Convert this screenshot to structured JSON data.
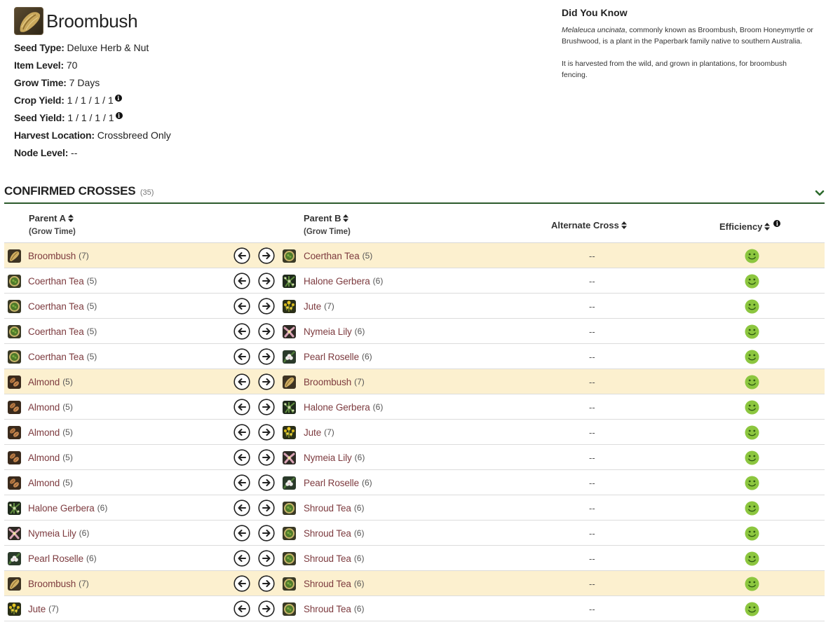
{
  "item": {
    "title": "Broombush",
    "icon": "broombush-icon",
    "props": [
      {
        "key": "Seed Type:",
        "value": "Deluxe Herb & Nut",
        "info": false
      },
      {
        "key": "Item Level:",
        "value": "70",
        "info": false
      },
      {
        "key": "Grow Time:",
        "value": "7 Days",
        "info": false
      },
      {
        "key": "Crop Yield:",
        "value": "1 / 1 / 1 / 1",
        "info": true
      },
      {
        "key": "Seed Yield:",
        "value": "1 / 1 / 1 / 1",
        "info": true
      },
      {
        "key": "Harvest Location:",
        "value": "Crossbreed Only",
        "info": false
      },
      {
        "key": "Node Level:",
        "value": "--",
        "info": false
      }
    ]
  },
  "did_you_know": {
    "title": "Did You Know",
    "sci_name": "Melaleuca uncinata",
    "p1_rest": ", commonly known as Broombush, Broom Honeymyrtle or Brushwood, is a plant in the Paperbark family native to southern Australia.",
    "p2": "It is harvested from the wild, and grown in plantations, for broombush fencing."
  },
  "section": {
    "title": "CONFIRMED CROSSES",
    "count": "(35)"
  },
  "columns": {
    "parent_a": "Parent A",
    "parent_a_sub": "(Grow Time)",
    "parent_b": "Parent B",
    "parent_b_sub": "(Grow Time)",
    "alternate": "Alternate Cross",
    "efficiency": "Efficiency"
  },
  "colors": {
    "accent": "#2c5a2c",
    "link": "#7d3b3f",
    "highlight": "#fcf0cf",
    "good": "#8cc63f"
  },
  "rows": [
    {
      "a": "Broombush",
      "a_gt": "(7)",
      "a_icon": "broombush",
      "b": "Coerthan Tea",
      "b_gt": "(5)",
      "b_icon": "tea",
      "alt": "--",
      "hl": true
    },
    {
      "a": "Coerthan Tea",
      "a_gt": "(5)",
      "a_icon": "tea",
      "b": "Halone Gerbera",
      "b_gt": "(6)",
      "b_icon": "gerbera",
      "alt": "--",
      "hl": false
    },
    {
      "a": "Coerthan Tea",
      "a_gt": "(5)",
      "a_icon": "tea",
      "b": "Jute",
      "b_gt": "(7)",
      "b_icon": "jute",
      "alt": "--",
      "hl": false
    },
    {
      "a": "Coerthan Tea",
      "a_gt": "(5)",
      "a_icon": "tea",
      "b": "Nymeia Lily",
      "b_gt": "(6)",
      "b_icon": "lily",
      "alt": "--",
      "hl": false
    },
    {
      "a": "Coerthan Tea",
      "a_gt": "(5)",
      "a_icon": "tea",
      "b": "Pearl Roselle",
      "b_gt": "(6)",
      "b_icon": "roselle",
      "alt": "--",
      "hl": false
    },
    {
      "a": "Almond",
      "a_gt": "(5)",
      "a_icon": "almond",
      "b": "Broombush",
      "b_gt": "(7)",
      "b_icon": "broombush",
      "alt": "--",
      "hl": true
    },
    {
      "a": "Almond",
      "a_gt": "(5)",
      "a_icon": "almond",
      "b": "Halone Gerbera",
      "b_gt": "(6)",
      "b_icon": "gerbera",
      "alt": "--",
      "hl": false
    },
    {
      "a": "Almond",
      "a_gt": "(5)",
      "a_icon": "almond",
      "b": "Jute",
      "b_gt": "(7)",
      "b_icon": "jute",
      "alt": "--",
      "hl": false
    },
    {
      "a": "Almond",
      "a_gt": "(5)",
      "a_icon": "almond",
      "b": "Nymeia Lily",
      "b_gt": "(6)",
      "b_icon": "lily",
      "alt": "--",
      "hl": false
    },
    {
      "a": "Almond",
      "a_gt": "(5)",
      "a_icon": "almond",
      "b": "Pearl Roselle",
      "b_gt": "(6)",
      "b_icon": "roselle",
      "alt": "--",
      "hl": false
    },
    {
      "a": "Halone Gerbera",
      "a_gt": "(6)",
      "a_icon": "gerbera",
      "b": "Shroud Tea",
      "b_gt": "(6)",
      "b_icon": "tea",
      "alt": "--",
      "hl": false
    },
    {
      "a": "Nymeia Lily",
      "a_gt": "(6)",
      "a_icon": "lily",
      "b": "Shroud Tea",
      "b_gt": "(6)",
      "b_icon": "tea",
      "alt": "--",
      "hl": false
    },
    {
      "a": "Pearl Roselle",
      "a_gt": "(6)",
      "a_icon": "roselle",
      "b": "Shroud Tea",
      "b_gt": "(6)",
      "b_icon": "tea",
      "alt": "--",
      "hl": false
    },
    {
      "a": "Broombush",
      "a_gt": "(7)",
      "a_icon": "broombush",
      "b": "Shroud Tea",
      "b_gt": "(6)",
      "b_icon": "tea",
      "alt": "--",
      "hl": true
    },
    {
      "a": "Jute",
      "a_gt": "(7)",
      "a_icon": "jute",
      "b": "Shroud Tea",
      "b_gt": "(6)",
      "b_icon": "tea",
      "alt": "--",
      "hl": false
    }
  ]
}
